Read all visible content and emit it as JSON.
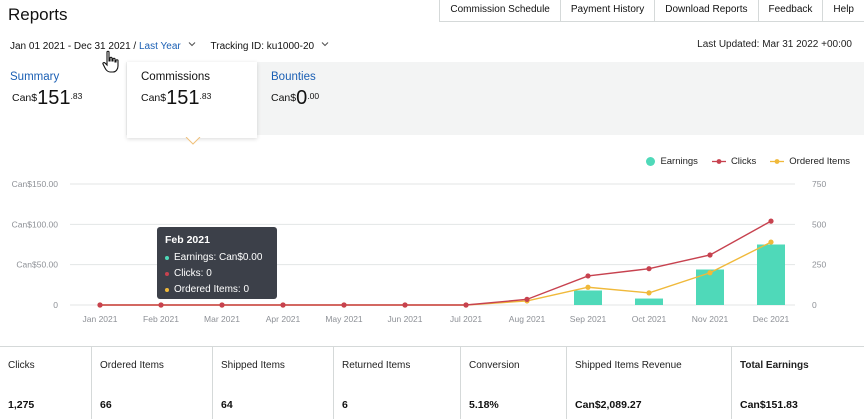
{
  "page": {
    "title": "Reports"
  },
  "top_nav": [
    "Commission Schedule",
    "Payment History",
    "Download Reports",
    "Feedback",
    "Help"
  ],
  "filters": {
    "date_range": "Jan 01 2021 - Dec 31 2021",
    "separator": " / ",
    "preset": "Last Year",
    "tracking_id": "Tracking ID: ku1000-20"
  },
  "last_updated": "Last Updated: Mar 31 2022 +00:00",
  "tabs": [
    {
      "label": "Summary",
      "currency": "Can$",
      "whole": "151",
      "cents": ".83"
    },
    {
      "label": "Commissions",
      "currency": "Can$",
      "whole": "151",
      "cents": ".83"
    },
    {
      "label": "Bounties",
      "currency": "Can$",
      "whole": "0",
      "cents": ".00"
    }
  ],
  "legend": {
    "earnings": "Earnings",
    "clicks": "Clicks",
    "ordered_items": "Ordered Items"
  },
  "colors": {
    "earnings": "#4fd9b9",
    "clicks": "#c7424f",
    "ordered_items": "#f0b93a",
    "link": "#1a5fb4",
    "tooltip_bg": "#3c4049"
  },
  "chart_data": {
    "type": "bar",
    "categories": [
      "Jan 2021",
      "Feb 2021",
      "Mar 2021",
      "Apr 2021",
      "May 2021",
      "Jun 2021",
      "Jul 2021",
      "Aug 2021",
      "Sep 2021",
      "Oct 2021",
      "Nov 2021",
      "Dec 2021"
    ],
    "y_left_ticks": [
      "Can$150.00",
      "Can$100.00",
      "Can$50.00",
      "0"
    ],
    "y_left_lim": [
      0,
      150
    ],
    "y_right_ticks": [
      "750",
      "500",
      "250",
      "0"
    ],
    "y_right_lim": [
      0,
      750
    ],
    "grid": true,
    "legend_position": "top-right",
    "series": [
      {
        "name": "Earnings",
        "axis": "left",
        "type": "bar",
        "values": [
          0,
          0,
          0,
          0,
          0,
          0,
          0,
          0,
          18,
          8,
          44,
          75
        ]
      },
      {
        "name": "Clicks",
        "axis": "right",
        "type": "line",
        "values": [
          0,
          0,
          0,
          0,
          0,
          0,
          0,
          35,
          180,
          225,
          310,
          520
        ]
      },
      {
        "name": "Ordered Items",
        "axis": "right",
        "type": "line",
        "values": [
          0,
          0,
          0,
          0,
          0,
          0,
          0,
          25,
          110,
          75,
          200,
          390
        ]
      }
    ]
  },
  "tooltip": {
    "title": "Feb 2021",
    "rows": [
      "Earnings: Can$0.00",
      "Clicks: 0",
      "Ordered Items: 0"
    ]
  },
  "metrics": [
    {
      "label": "Clicks",
      "value": "1,275"
    },
    {
      "label": "Ordered Items",
      "value": "66"
    },
    {
      "label": "Shipped Items",
      "value": "64"
    },
    {
      "label": "Returned Items",
      "value": "6"
    },
    {
      "label": "Conversion",
      "value": "5.18%"
    },
    {
      "label": "Shipped Items Revenue",
      "value": "Can$2,089.27"
    },
    {
      "label": "Total Earnings",
      "value": "Can$151.83"
    }
  ]
}
